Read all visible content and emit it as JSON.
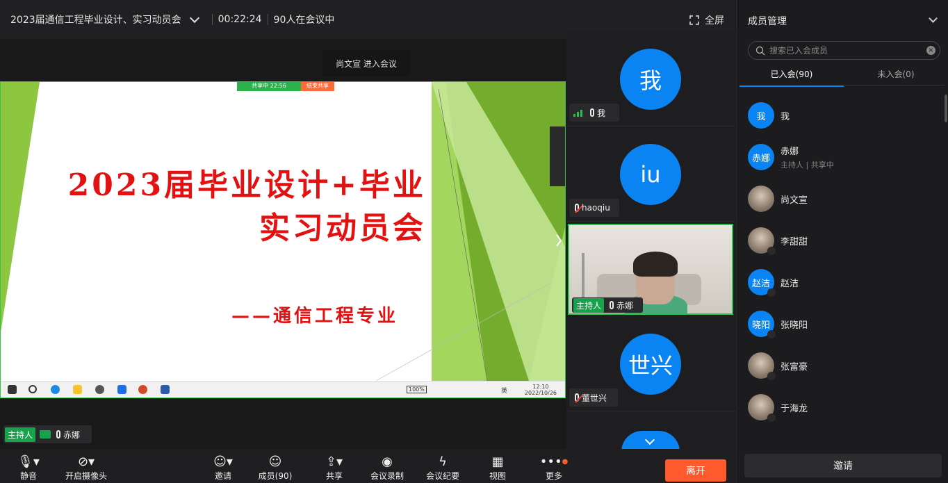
{
  "topbar": {
    "title": "2023届通信工程毕业设计、实习动员会",
    "elapsed": "00:22:24",
    "attendees": "90人在会议中",
    "fullscreen": "全屏"
  },
  "toast": "尚文宣 进入会议",
  "slide": {
    "share_status": "共享中 22:56",
    "stop_share": "结束共享",
    "title_line1": "2023届毕业设计+毕业",
    "title_line2": "实习动员会",
    "subtitle": "——通信工程专业",
    "taskbar": {
      "battery": "100%",
      "time": "12:10",
      "date": "2022/10/26",
      "lang": "英"
    }
  },
  "speaker": {
    "role": "主持人",
    "name": "赤娜"
  },
  "tiles": [
    {
      "avatar": "我",
      "name": "我",
      "mic": "active"
    },
    {
      "avatar": "iu",
      "name": "haoqiu",
      "mic": "muted"
    },
    {
      "video": true,
      "role": "主持人",
      "name": "赤娜",
      "mic": "on"
    },
    {
      "avatar": "世兴",
      "name": "董世兴",
      "mic": "muted"
    }
  ],
  "toolbar": {
    "mute": "静音",
    "camera": "开启摄像头",
    "invite": "邀请",
    "members": "成员(90)",
    "share": "共享",
    "record": "会议录制",
    "summary": "会议纪要",
    "view": "视图",
    "more": "更多",
    "leave": "离开"
  },
  "panel": {
    "header": "成员管理",
    "search_placeholder": "搜索已入会成员",
    "tab_joined": "已入会(90)",
    "tab_notjoined": "未入会(0)",
    "members": [
      {
        "avatar": "我",
        "name": "我",
        "sub": ""
      },
      {
        "avatar": "赤娜",
        "name": "赤娜",
        "sub": "主持人 | 共享中"
      },
      {
        "avatar": "",
        "name": "尚文宣",
        "sub": ""
      },
      {
        "avatar": "",
        "name": "李甜甜",
        "sub": ""
      },
      {
        "avatar": "赵洁",
        "name": "赵洁",
        "sub": ""
      },
      {
        "avatar": "晓阳",
        "name": "张晓阳",
        "sub": ""
      },
      {
        "avatar": "",
        "name": "张富豪",
        "sub": ""
      },
      {
        "avatar": "",
        "name": "于海龙",
        "sub": ""
      }
    ],
    "invite": "邀请"
  }
}
